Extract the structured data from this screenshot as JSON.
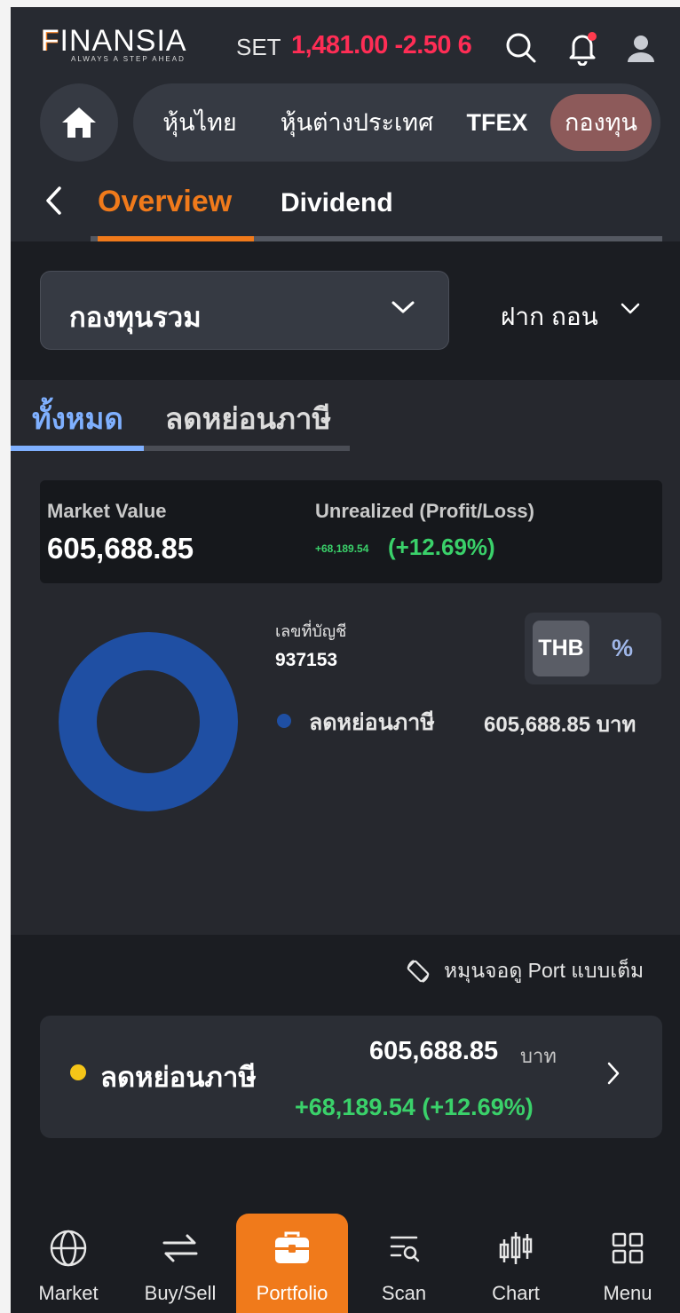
{
  "header": {
    "logo_text": "FINANSIA",
    "logo_tagline": "ALWAYS A STEP AHEAD",
    "set_label": "SET",
    "set_value": "1,481.00 -2.50 6",
    "icons": [
      "search-icon",
      "bell-icon",
      "user-icon"
    ]
  },
  "market_tabs": {
    "items": [
      "หุ้นไทย",
      "หุ้นต่างประเทศ",
      "TFEX",
      "กองทุน"
    ],
    "active": "กองทุน"
  },
  "page_tabs": {
    "overview": "Overview",
    "dividend": "Dividend",
    "active": "Overview"
  },
  "selector": {
    "fund_type": "กองทุนรวม",
    "action": "ฝาก ถอน"
  },
  "sub_tabs": {
    "all": "ทั้งหมด",
    "tax": "ลดหย่อนภาษี",
    "active": "ทั้งหมด"
  },
  "summary": {
    "market_value_label": "Market Value",
    "market_value": "605,688.85",
    "unrealized_label": "Unrealized (Profit/Loss)",
    "unrealized_amount": "+68,189.54",
    "unrealized_pct": "(+12.69%)"
  },
  "account": {
    "label": "เลขที่บัญชี",
    "number": "937153"
  },
  "unit_toggle": {
    "thb": "THB",
    "pct": "%",
    "active": "THB"
  },
  "chart_data": {
    "type": "pie",
    "categories": [
      "ลดหย่อนภาษี"
    ],
    "values": [
      605688.85
    ],
    "unit": "บาท",
    "colors": [
      "#1f4fa3"
    ]
  },
  "legend": {
    "label": "ลดหย่อนภาษี",
    "value": "605,688.85 บาท"
  },
  "rotate_hint": "หมุนจอดู Port แบบเต็ม",
  "fund_card": {
    "name": "ลดหย่อนภาษี",
    "value": "605,688.85",
    "unit": "บาท",
    "pl": "+68,189.54 (+12.69%)",
    "dot_color": "#f5c518"
  },
  "bottom_nav": {
    "items": [
      "Market",
      "Buy/Sell",
      "Portfolio",
      "Scan",
      "Chart",
      "Menu"
    ],
    "active": "Portfolio"
  },
  "colors": {
    "accent": "#f07a1b",
    "down": "#ff2d55",
    "up": "#3ad16a",
    "tab_blue": "#7fb0ff"
  }
}
